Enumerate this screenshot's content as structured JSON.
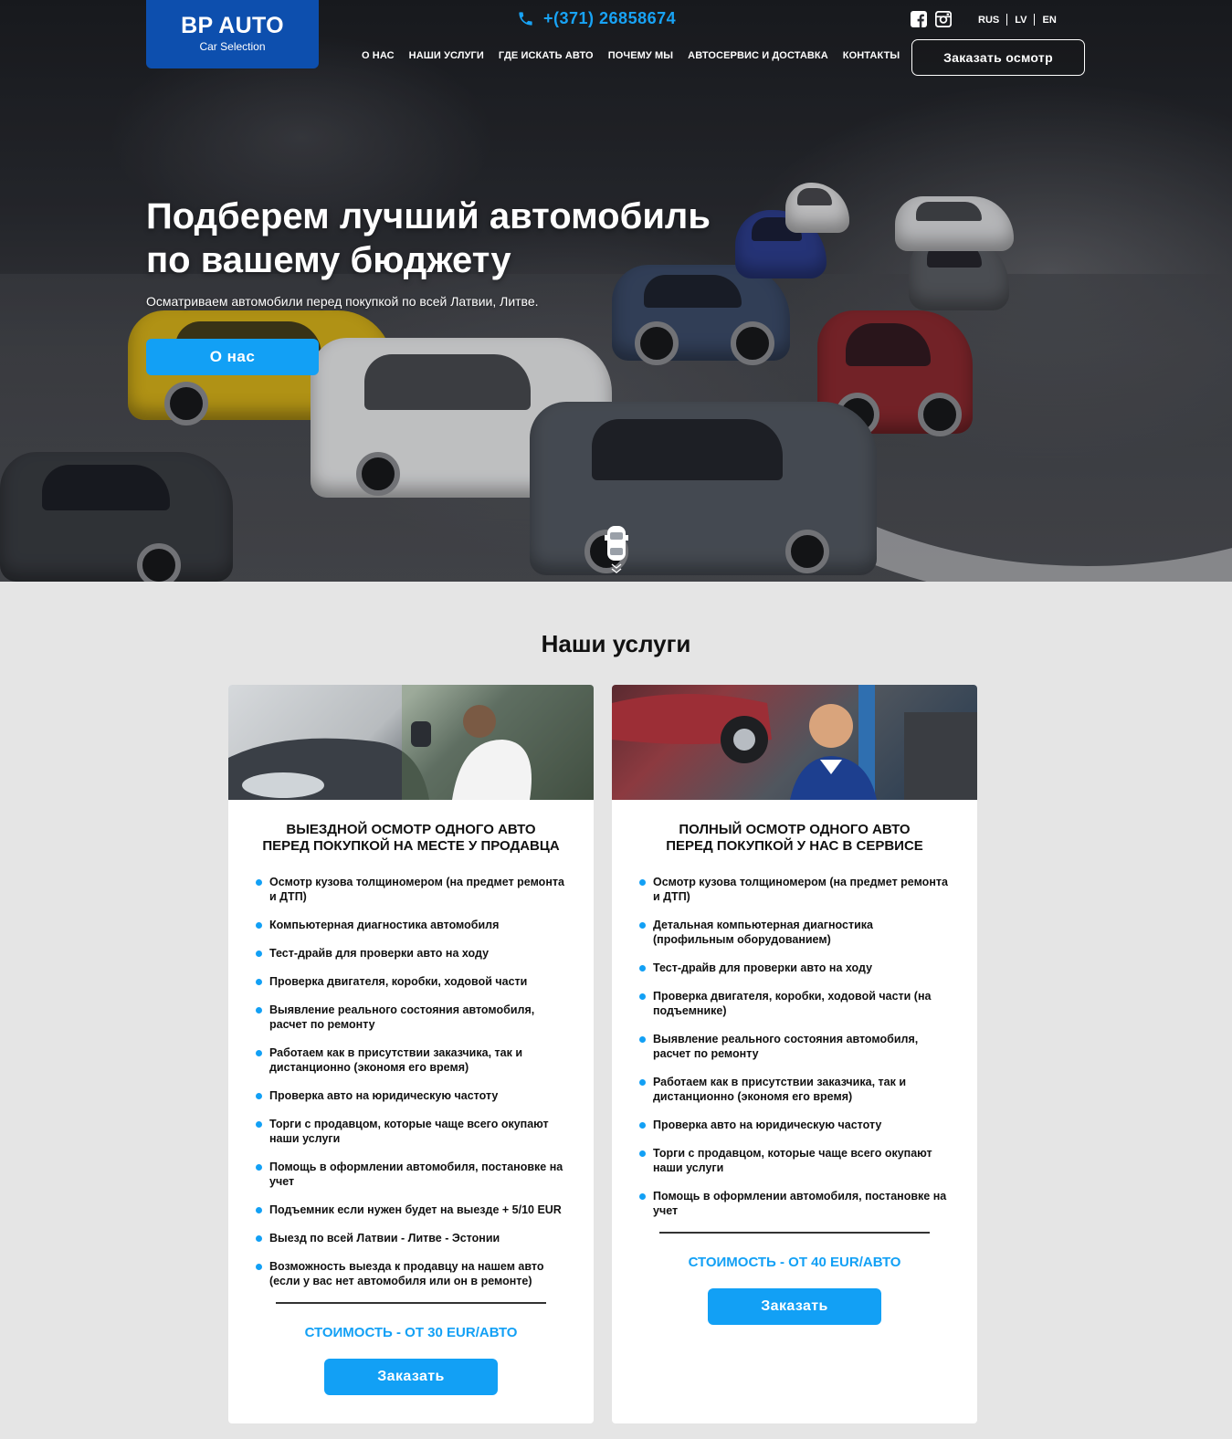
{
  "brand": {
    "name": "BP AUTO",
    "tagline": "Car Selection",
    "accent": "#12a0f5",
    "logo_bg": "#0d4fae"
  },
  "header": {
    "phone": "+(371) 26858674",
    "social": [
      "facebook-icon",
      "instagram-icon"
    ],
    "languages": [
      "RUS",
      "LV",
      "EN"
    ],
    "nav": [
      "О НАС",
      "НАШИ УСЛУГИ",
      "ГДЕ ИСКАТЬ АВТО",
      "ПОЧЕМУ МЫ",
      "АВТОСЕРВИС И ДОСТАВКА",
      "КОНТАКТЫ"
    ],
    "cta": "Заказать осмотр"
  },
  "hero": {
    "title_line1": "Подберем лучший автомобиль",
    "title_line2": "по вашему бюджету",
    "subtitle": "Осматриваем автомобили перед покупкой по всей Латвии, Литве.",
    "button": "О нас"
  },
  "services": {
    "title": "Наши услуги",
    "cards": [
      {
        "heading_line1": "ВЫЕЗДНОЙ ОСМОТР ОДНОГО АВТО",
        "heading_line2": "ПЕРЕД ПОКУПКОЙ НА МЕСТЕ У ПРОДАВЦА",
        "items": [
          "Осмотр кузова толщиномером (на предмет ремонта и ДТП)",
          "Компьютерная диагностика автомобиля",
          "Тест-драйв для проверки авто на ходу",
          "Проверка двигателя, коробки, ходовой части",
          "Выявление реального состояния автомобиля, расчет по ремонту",
          "Работаем как в присутствии заказчика, так и дистанционно (экономя его время)",
          "Проверка авто на юридическую частоту",
          "Торги с продавцом, которые чаще всего окупают наши услуги",
          "Помощь в оформлении автомобиля, постановке на учет",
          "Подъемник если нужен будет на выезде + 5/10 EUR",
          "Выезд по всей Латвии - Литве - Эстонии",
          "Возможность выезда к продавцу на нашем авто (если у вас нет автомобиля или он в ремонте)"
        ],
        "price": "СТОИМОСТЬ - ОТ 30 EUR/АВТО",
        "button": "Заказать"
      },
      {
        "heading_line1": "ПОЛНЫЙ ОСМОТР ОДНОГО АВТО",
        "heading_line2": "ПЕРЕД ПОКУПКОЙ У НАС В СЕРВИСЕ",
        "items": [
          "Осмотр кузова толщиномером (на предмет ремонта и ДТП)",
          "Детальная компьютерная диагностика (профильным оборудованием)",
          "Тест-драйв для проверки авто на ходу",
          "Проверка двигателя, коробки, ходовой части (на подъемнике)",
          "Выявление реального состояния автомобиля, расчет по ремонту",
          "Работаем как в присутствии заказчика, так и дистанционно (экономя его время)",
          "Проверка авто на юридическую частоту",
          "Торги с продавцом, которые чаще всего окупают наши услуги",
          "Помощь в оформлении автомобиля, постановке на учет"
        ],
        "price": "СТОИМОСТЬ - ОТ 40 EUR/АВТО",
        "button": "Заказать"
      }
    ]
  }
}
